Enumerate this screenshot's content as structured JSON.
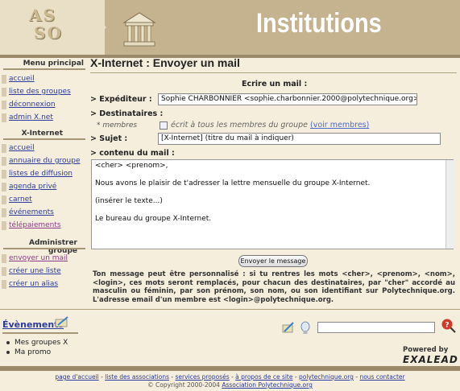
{
  "header": {
    "logo_text_line1": "AS",
    "logo_text_line2": "SO",
    "banner_title": "Institutions"
  },
  "sidebar": {
    "main_menu_title": "Menu principal",
    "main_items": [
      {
        "label": "accueil"
      },
      {
        "label": "liste des groupes"
      },
      {
        "label": "déconnexion"
      },
      {
        "label": "admin X.net"
      }
    ],
    "group_title": "X-Internet",
    "group_items": [
      {
        "label": "accueil"
      },
      {
        "label": "annuaire du groupe"
      },
      {
        "label": "listes de diffusion"
      },
      {
        "label": "agenda privé"
      },
      {
        "label": "carnet"
      },
      {
        "label": "événements"
      },
      {
        "label": "télépaiements"
      }
    ],
    "admin_title": "Administrer groupe",
    "admin_items": [
      {
        "label": "envoyer un mail"
      },
      {
        "label": "créer une liste"
      },
      {
        "label": "créer un alias"
      }
    ]
  },
  "main": {
    "page_title": "X-Internet : Envoyer un mail",
    "form_title": "Ecrire un mail :",
    "sender_label": "> Expéditeur :",
    "sender_value": "Sophie CHARBONNIER <sophie.charbonnier.2000@polytechnique.org>",
    "recipients_label": "> Destinataires :",
    "members_label": "* membres",
    "members_checkbox_text": "écrit à tous les membres du groupe",
    "see_members_link": "(voir membres)",
    "subject_label": "> Sujet :",
    "subject_value": "[X-Internet] (titre du mail à indiquer)",
    "content_label": "> contenu du mail :",
    "message_body": "<cher> <prenom>,\n\nNous avons le plaisir de t'adresser la lettre mensuelle du groupe X-Internet.\n\n(insérer le texte...)\n\nLe bureau du groupe X-Internet.",
    "send_button": "Envoyer le message",
    "info_text": "Ton message peut être personnalisé : si tu rentres les mots <cher>, <prenom>, <nom>, <login>, ces mots seront remplacés, pour chacun des destinataires, par \"cher\" accordé au masculin ou féminin, par son prénom, son nom, ou son identifiant sur Polytechnique.org. L'adresse email d'un membre est <login>@polytechnique.org."
  },
  "events": {
    "title": "Évènements",
    "items": [
      "Mes groupes X",
      "Ma promo"
    ]
  },
  "search": {
    "placeholder": "",
    "powered_by": "Powered by",
    "engine": "EXALEAD"
  },
  "footer": {
    "links": [
      "page d'accueil",
      "liste des associations",
      "services proposés",
      "à propos de ce site",
      "polytechnique.org",
      "nous contacter"
    ],
    "copyright_prefix": "© Copyright 2000-2004",
    "copyright_link": "Association Polytechnique.org"
  }
}
